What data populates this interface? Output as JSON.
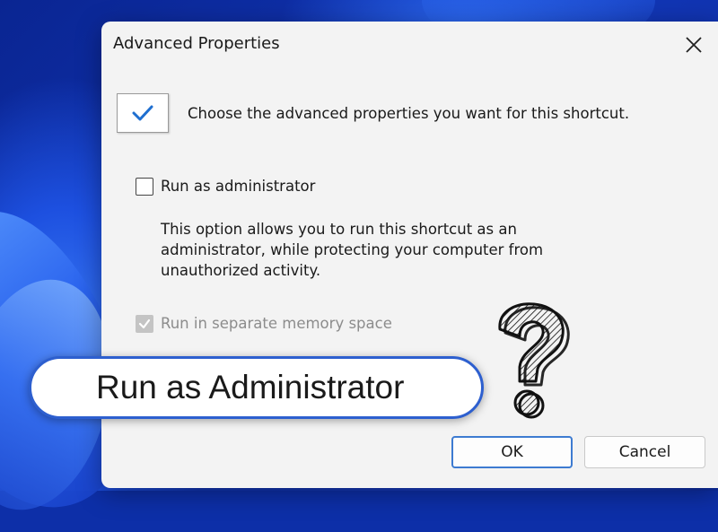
{
  "dialog": {
    "title": "Advanced Properties",
    "instructions": "Choose the advanced properties you want for this shortcut.",
    "options": {
      "run_as_admin": {
        "label": "Run as administrator",
        "checked": false
      },
      "description_lines": [
        "This option allows you to run this shortcut as an",
        "administrator, while protecting your computer from",
        "unauthorized activity."
      ],
      "separate_memory": {
        "label": "Run in separate memory space",
        "checked": true,
        "disabled": true
      }
    },
    "buttons": {
      "ok": "OK",
      "cancel": "Cancel"
    }
  },
  "overlay": {
    "caption": "Run as Administrator"
  },
  "icons": [
    "close-icon",
    "checkmark-icon",
    "question-mark-icon"
  ],
  "colors": {
    "accent": "#2d5fcf",
    "ok_border": "#3d7bd1",
    "check_blue": "#1f6fd0"
  }
}
